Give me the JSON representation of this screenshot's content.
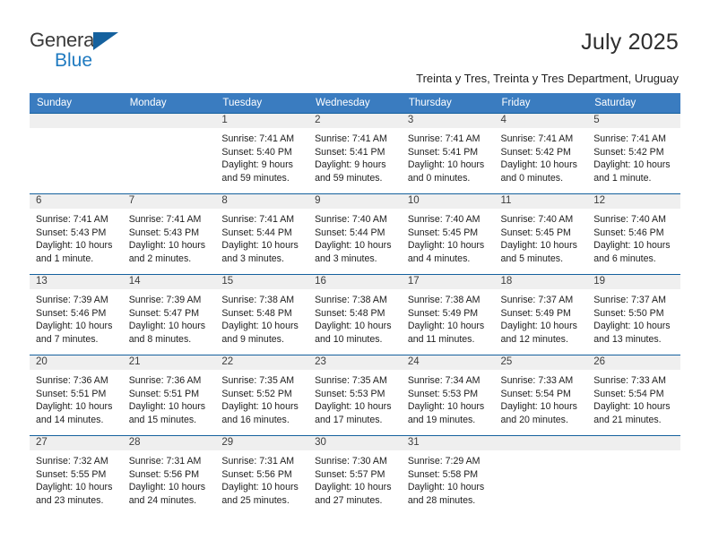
{
  "brand": {
    "name_top": "General",
    "name_bottom": "Blue",
    "triangle_color": "#15619e",
    "blue_color": "#1f7ac0"
  },
  "header": {
    "title": "July 2025",
    "subtitle": "Treinta y Tres, Treinta y Tres Department, Uruguay"
  },
  "colors": {
    "header_row_bg": "#3a7cc0",
    "week_border": "#15619e",
    "daynum_band": "#efefef"
  },
  "weekday_headers": [
    "Sunday",
    "Monday",
    "Tuesday",
    "Wednesday",
    "Thursday",
    "Friday",
    "Saturday"
  ],
  "labels": {
    "sunrise_prefix": "Sunrise:",
    "sunset_prefix": "Sunset:",
    "daylight_prefix": "Daylight:"
  },
  "weeks": [
    [
      {
        "day": "",
        "sunrise": "",
        "sunset": "",
        "daylight": "",
        "empty": true
      },
      {
        "day": "",
        "sunrise": "",
        "sunset": "",
        "daylight": "",
        "empty": true
      },
      {
        "day": "1",
        "sunrise": "Sunrise: 7:41 AM",
        "sunset": "Sunset: 5:40 PM",
        "daylight": "Daylight: 9 hours and 59 minutes.",
        "empty": false
      },
      {
        "day": "2",
        "sunrise": "Sunrise: 7:41 AM",
        "sunset": "Sunset: 5:41 PM",
        "daylight": "Daylight: 9 hours and 59 minutes.",
        "empty": false
      },
      {
        "day": "3",
        "sunrise": "Sunrise: 7:41 AM",
        "sunset": "Sunset: 5:41 PM",
        "daylight": "Daylight: 10 hours and 0 minutes.",
        "empty": false
      },
      {
        "day": "4",
        "sunrise": "Sunrise: 7:41 AM",
        "sunset": "Sunset: 5:42 PM",
        "daylight": "Daylight: 10 hours and 0 minutes.",
        "empty": false
      },
      {
        "day": "5",
        "sunrise": "Sunrise: 7:41 AM",
        "sunset": "Sunset: 5:42 PM",
        "daylight": "Daylight: 10 hours and 1 minute.",
        "empty": false
      }
    ],
    [
      {
        "day": "6",
        "sunrise": "Sunrise: 7:41 AM",
        "sunset": "Sunset: 5:43 PM",
        "daylight": "Daylight: 10 hours and 1 minute.",
        "empty": false
      },
      {
        "day": "7",
        "sunrise": "Sunrise: 7:41 AM",
        "sunset": "Sunset: 5:43 PM",
        "daylight": "Daylight: 10 hours and 2 minutes.",
        "empty": false
      },
      {
        "day": "8",
        "sunrise": "Sunrise: 7:41 AM",
        "sunset": "Sunset: 5:44 PM",
        "daylight": "Daylight: 10 hours and 3 minutes.",
        "empty": false
      },
      {
        "day": "9",
        "sunrise": "Sunrise: 7:40 AM",
        "sunset": "Sunset: 5:44 PM",
        "daylight": "Daylight: 10 hours and 3 minutes.",
        "empty": false
      },
      {
        "day": "10",
        "sunrise": "Sunrise: 7:40 AM",
        "sunset": "Sunset: 5:45 PM",
        "daylight": "Daylight: 10 hours and 4 minutes.",
        "empty": false
      },
      {
        "day": "11",
        "sunrise": "Sunrise: 7:40 AM",
        "sunset": "Sunset: 5:45 PM",
        "daylight": "Daylight: 10 hours and 5 minutes.",
        "empty": false
      },
      {
        "day": "12",
        "sunrise": "Sunrise: 7:40 AM",
        "sunset": "Sunset: 5:46 PM",
        "daylight": "Daylight: 10 hours and 6 minutes.",
        "empty": false
      }
    ],
    [
      {
        "day": "13",
        "sunrise": "Sunrise: 7:39 AM",
        "sunset": "Sunset: 5:46 PM",
        "daylight": "Daylight: 10 hours and 7 minutes.",
        "empty": false
      },
      {
        "day": "14",
        "sunrise": "Sunrise: 7:39 AM",
        "sunset": "Sunset: 5:47 PM",
        "daylight": "Daylight: 10 hours and 8 minutes.",
        "empty": false
      },
      {
        "day": "15",
        "sunrise": "Sunrise: 7:38 AM",
        "sunset": "Sunset: 5:48 PM",
        "daylight": "Daylight: 10 hours and 9 minutes.",
        "empty": false
      },
      {
        "day": "16",
        "sunrise": "Sunrise: 7:38 AM",
        "sunset": "Sunset: 5:48 PM",
        "daylight": "Daylight: 10 hours and 10 minutes.",
        "empty": false
      },
      {
        "day": "17",
        "sunrise": "Sunrise: 7:38 AM",
        "sunset": "Sunset: 5:49 PM",
        "daylight": "Daylight: 10 hours and 11 minutes.",
        "empty": false
      },
      {
        "day": "18",
        "sunrise": "Sunrise: 7:37 AM",
        "sunset": "Sunset: 5:49 PM",
        "daylight": "Daylight: 10 hours and 12 minutes.",
        "empty": false
      },
      {
        "day": "19",
        "sunrise": "Sunrise: 7:37 AM",
        "sunset": "Sunset: 5:50 PM",
        "daylight": "Daylight: 10 hours and 13 minutes.",
        "empty": false
      }
    ],
    [
      {
        "day": "20",
        "sunrise": "Sunrise: 7:36 AM",
        "sunset": "Sunset: 5:51 PM",
        "daylight": "Daylight: 10 hours and 14 minutes.",
        "empty": false
      },
      {
        "day": "21",
        "sunrise": "Sunrise: 7:36 AM",
        "sunset": "Sunset: 5:51 PM",
        "daylight": "Daylight: 10 hours and 15 minutes.",
        "empty": false
      },
      {
        "day": "22",
        "sunrise": "Sunrise: 7:35 AM",
        "sunset": "Sunset: 5:52 PM",
        "daylight": "Daylight: 10 hours and 16 minutes.",
        "empty": false
      },
      {
        "day": "23",
        "sunrise": "Sunrise: 7:35 AM",
        "sunset": "Sunset: 5:53 PM",
        "daylight": "Daylight: 10 hours and 17 minutes.",
        "empty": false
      },
      {
        "day": "24",
        "sunrise": "Sunrise: 7:34 AM",
        "sunset": "Sunset: 5:53 PM",
        "daylight": "Daylight: 10 hours and 19 minutes.",
        "empty": false
      },
      {
        "day": "25",
        "sunrise": "Sunrise: 7:33 AM",
        "sunset": "Sunset: 5:54 PM",
        "daylight": "Daylight: 10 hours and 20 minutes.",
        "empty": false
      },
      {
        "day": "26",
        "sunrise": "Sunrise: 7:33 AM",
        "sunset": "Sunset: 5:54 PM",
        "daylight": "Daylight: 10 hours and 21 minutes.",
        "empty": false
      }
    ],
    [
      {
        "day": "27",
        "sunrise": "Sunrise: 7:32 AM",
        "sunset": "Sunset: 5:55 PM",
        "daylight": "Daylight: 10 hours and 23 minutes.",
        "empty": false
      },
      {
        "day": "28",
        "sunrise": "Sunrise: 7:31 AM",
        "sunset": "Sunset: 5:56 PM",
        "daylight": "Daylight: 10 hours and 24 minutes.",
        "empty": false
      },
      {
        "day": "29",
        "sunrise": "Sunrise: 7:31 AM",
        "sunset": "Sunset: 5:56 PM",
        "daylight": "Daylight: 10 hours and 25 minutes.",
        "empty": false
      },
      {
        "day": "30",
        "sunrise": "Sunrise: 7:30 AM",
        "sunset": "Sunset: 5:57 PM",
        "daylight": "Daylight: 10 hours and 27 minutes.",
        "empty": false
      },
      {
        "day": "31",
        "sunrise": "Sunrise: 7:29 AM",
        "sunset": "Sunset: 5:58 PM",
        "daylight": "Daylight: 10 hours and 28 minutes.",
        "empty": false
      },
      {
        "day": "",
        "sunrise": "",
        "sunset": "",
        "daylight": "",
        "empty": true
      },
      {
        "day": "",
        "sunrise": "",
        "sunset": "",
        "daylight": "",
        "empty": true
      }
    ]
  ]
}
